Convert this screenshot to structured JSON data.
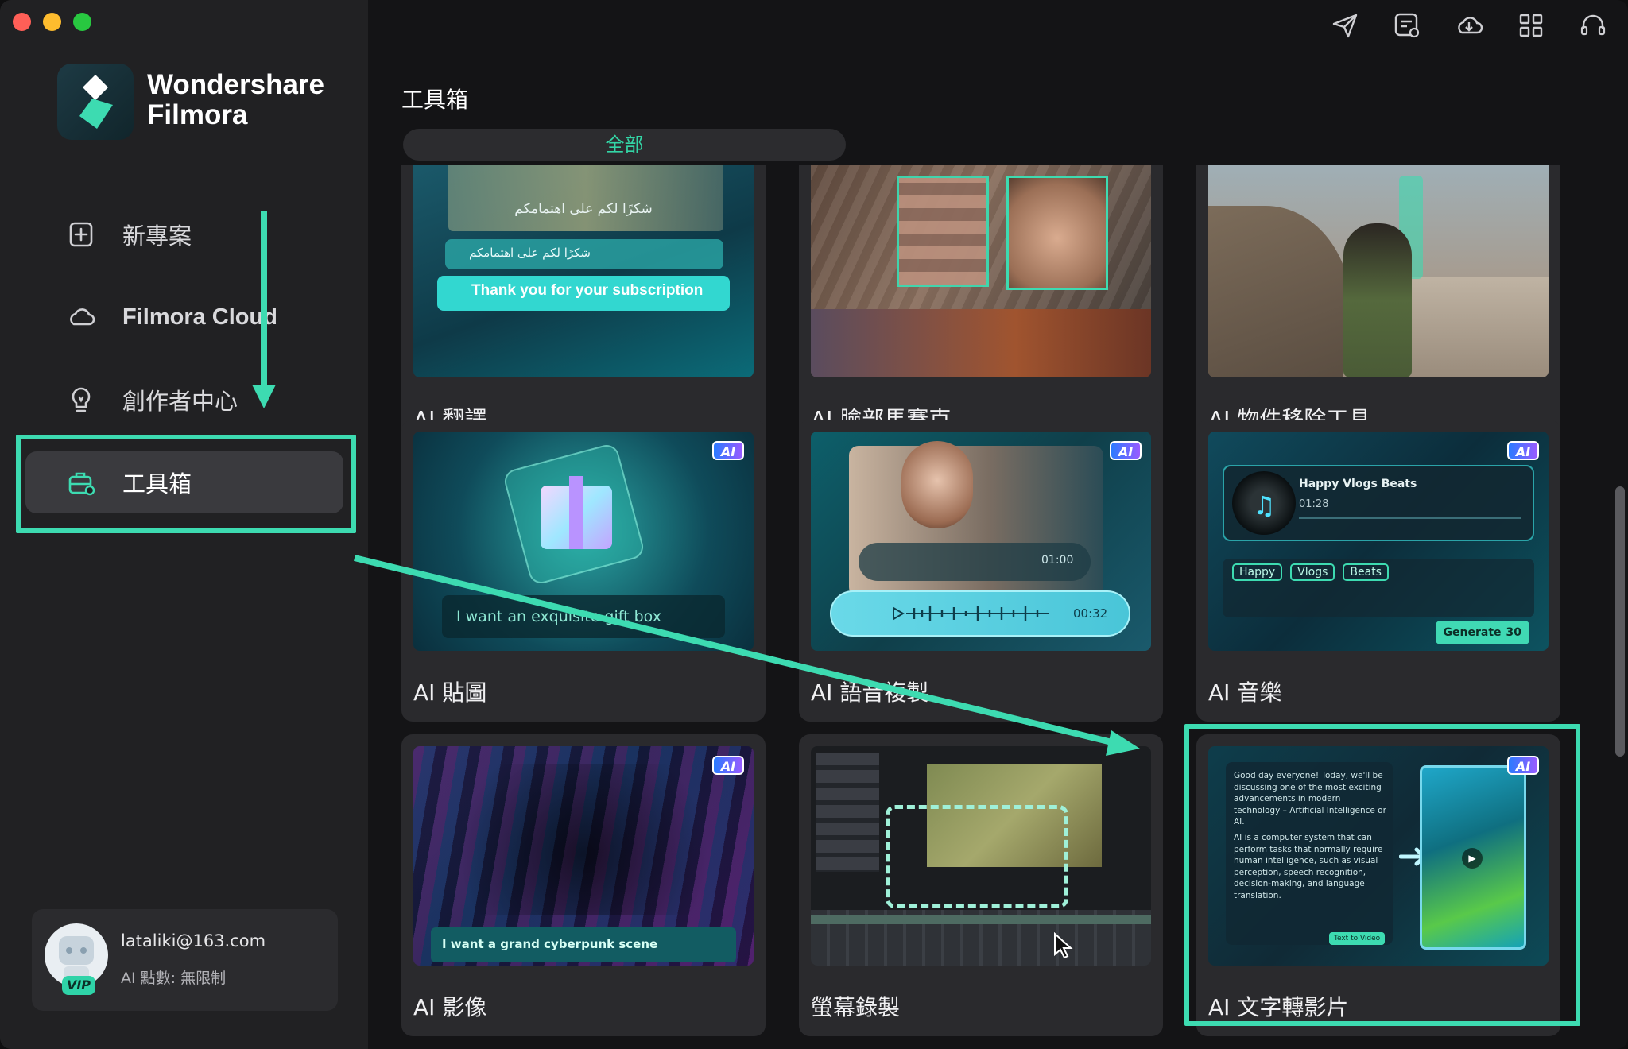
{
  "app": {
    "name_line1": "Wondershare",
    "name_line2": "Filmora"
  },
  "sidebar": {
    "items": [
      {
        "label": "新專案",
        "icon": "new-project-icon"
      },
      {
        "label": "Filmora Cloud",
        "icon": "cloud-icon"
      },
      {
        "label": "創作者中心",
        "icon": "lightbulb-icon"
      },
      {
        "label": "工具箱",
        "icon": "toolbox-icon",
        "active": true
      }
    ],
    "user": {
      "email": "lataliki@163.com",
      "quota": "AI 點數: 無限制",
      "badge": "VIP"
    }
  },
  "topbar": {
    "icons": [
      "send-icon",
      "feedback-icon",
      "cloud-upload-icon",
      "apps-grid-icon",
      "support-headset-icon"
    ]
  },
  "main": {
    "title": "工具箱",
    "filter": "全部",
    "ai_badge": "AI",
    "cards": [
      {
        "label": "AI 翻譯",
        "thumb": {
          "arabic": "شكرًا لكم على اهتمامكم",
          "subtitle": "Thank you for your subscription"
        }
      },
      {
        "label": "AI 臉部馬賽克"
      },
      {
        "label": "AI 物件移除工具"
      },
      {
        "label": "AI 貼圖",
        "thumb": {
          "prompt": "I want an exquisite gift box"
        }
      },
      {
        "label": "AI 語音複製",
        "thumb": {
          "time1": "01:00",
          "time2": "00:32"
        }
      },
      {
        "label": "AI 音樂",
        "thumb": {
          "track": "Happy Vlogs Beats",
          "duration": "01:28",
          "tags": [
            "Happy",
            "Vlogs",
            "Beats"
          ],
          "generate": "Generate",
          "credits": "30"
        }
      },
      {
        "label": "AI 影像",
        "thumb": {
          "prompt": "I want a grand cyberpunk scene"
        }
      },
      {
        "label": "螢幕錄製"
      },
      {
        "label": "AI 文字轉影片",
        "thumb": {
          "para1": "Good day everyone! Today, we'll be discussing one of the most exciting advancements in modern technology – Artificial Intelligence or AI.",
          "para2": "AI is a computer system that can perform tasks that normally require human intelligence, such as visual perception, speech recognition, decision-making, and language translation.",
          "button": "Text to Video"
        }
      }
    ]
  },
  "colors": {
    "accent": "#3ddbb1",
    "sidebar_bg": "#212123",
    "main_bg": "#141416",
    "card_bg": "#2a2a2d"
  }
}
